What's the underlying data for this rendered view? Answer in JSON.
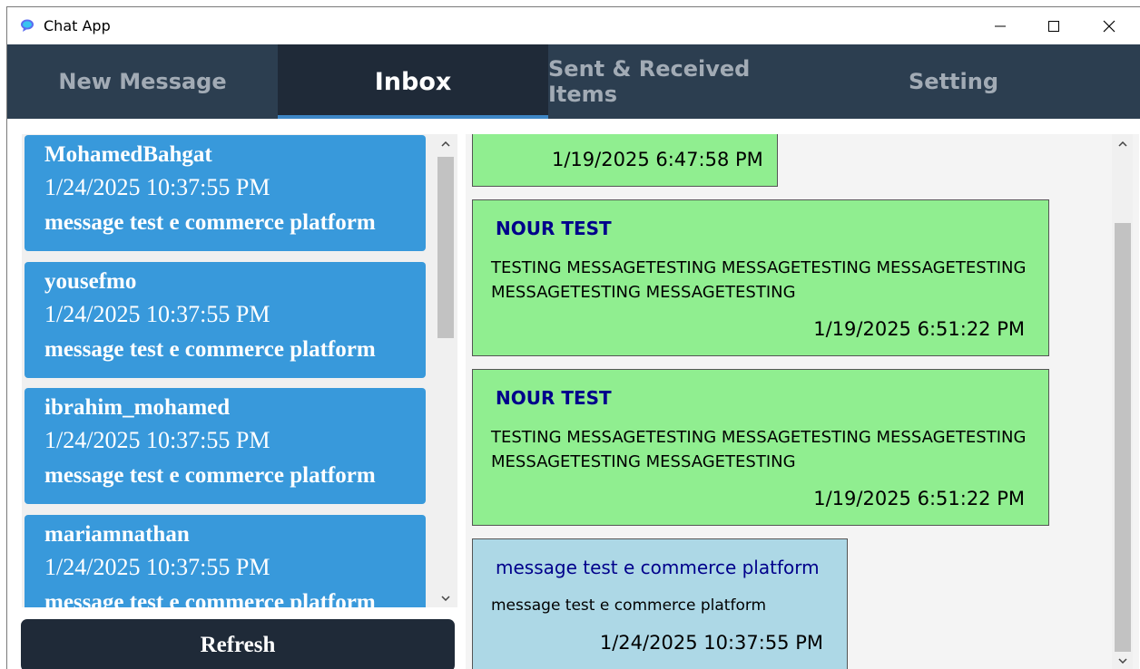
{
  "window": {
    "title": "Chat App",
    "controls": {
      "minimize": "minimize",
      "maximize": "maximize",
      "close": "close"
    }
  },
  "tabs": [
    {
      "label": "New Message",
      "active": false
    },
    {
      "label": "Inbox",
      "active": true
    },
    {
      "label": "Sent & Received Items",
      "active": false
    },
    {
      "label": "Setting",
      "active": false
    }
  ],
  "inbox": {
    "contacts": [
      {
        "name": "MohamedBahgat",
        "time": "1/24/2025 10:37:55 PM",
        "preview": "message test e commerce platform"
      },
      {
        "name": "yousefmo",
        "time": "1/24/2025 10:37:55 PM",
        "preview": "message test e commerce platform"
      },
      {
        "name": "ibrahim_mohamed",
        "time": "1/24/2025 10:37:55 PM",
        "preview": "message test e commerce platform"
      },
      {
        "name": "mariamnathan",
        "time": "1/24/2025 10:37:55 PM",
        "preview": "message test e commerce platform"
      }
    ],
    "refresh_label": "Refresh"
  },
  "conversation": {
    "messages": [
      {
        "sender": "",
        "text": "",
        "time": "1/19/2025 6:47:58 PM",
        "color": "#90ee90"
      },
      {
        "sender": "NOUR TEST",
        "text": "TESTING MESSAGETESTING MESSAGETESTING MESSAGETESTING MESSAGETESTING MESSAGETESTING",
        "time": "1/19/2025 6:51:22 PM",
        "color": "#90ee90"
      },
      {
        "sender": "NOUR TEST",
        "text": "TESTING MESSAGETESTING MESSAGETESTING MESSAGETESTING MESSAGETESTING MESSAGETESTING",
        "time": "1/19/2025 6:51:22 PM",
        "color": "#90ee90"
      },
      {
        "sender": "message test e commerce platform",
        "text": "message test e commerce platform",
        "time": "1/24/2025 10:37:55 PM",
        "color": "#add8e6"
      }
    ]
  },
  "colors": {
    "tabbar": "#2c3e50",
    "active_tab": "#1f2a38",
    "tab_indicator": "#3d86c6",
    "contact_card": "#3899db",
    "sent_bubble": "#90ee90",
    "received_bubble": "#add8e6",
    "sender_name": "#00008b"
  }
}
